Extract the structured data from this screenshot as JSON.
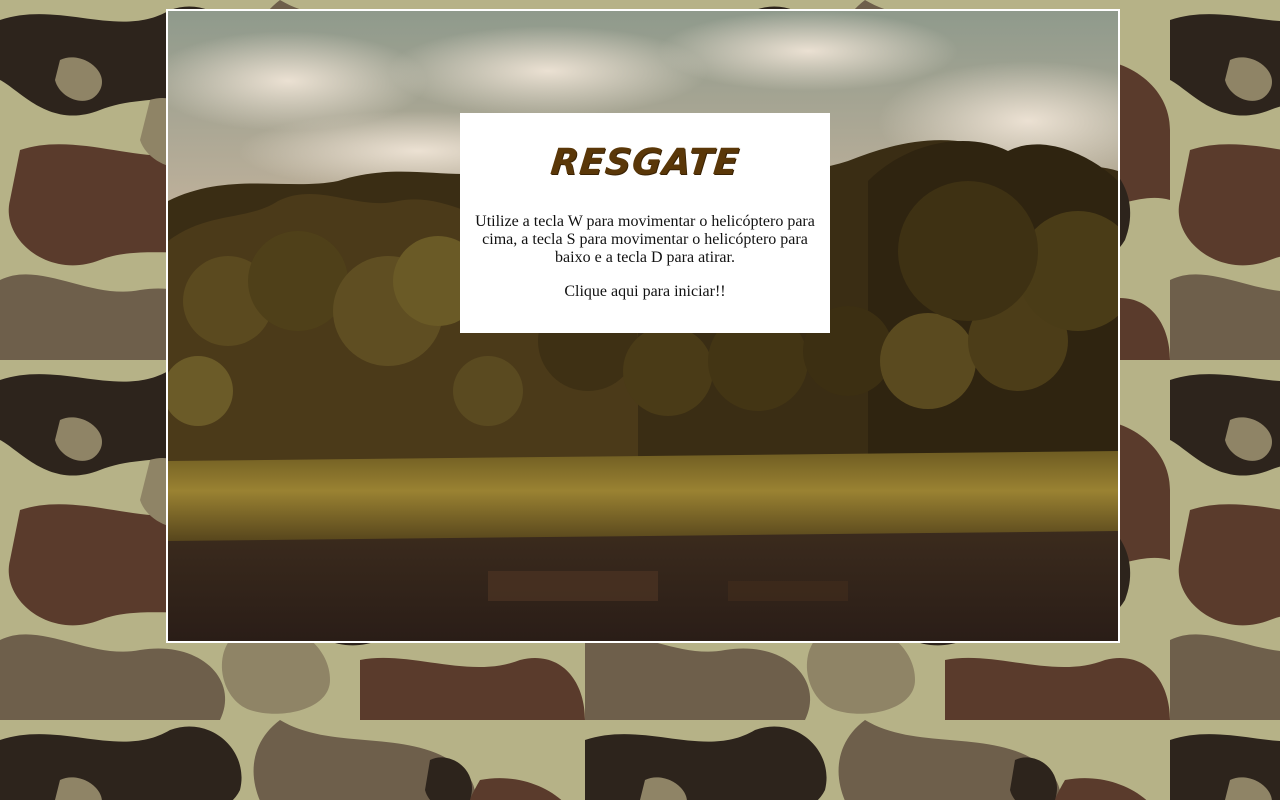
{
  "game": {
    "title": "RESGATE",
    "instructions": "Utilize a tecla W para movimentar o helicóptero para cima, a tecla S para movimentar o helicóptero para baixo e a tecla D para atirar.",
    "start_prompt": "Clique aqui para iniciar!!"
  },
  "background": {
    "pattern": "camouflage",
    "colors": [
      "#b6b287",
      "#6e5f4b",
      "#5a3b2c",
      "#2d241c",
      "#8f8466"
    ]
  },
  "scene": {
    "description_icon": "forest-landscape",
    "sky_color": "#c8bba3",
    "foliage_color": "#3a2d14",
    "grass_color": "#8a7428"
  },
  "colors": {
    "title": "#5a3708",
    "panel_bg": "#ffffff",
    "frame_border": "#ffffff"
  }
}
